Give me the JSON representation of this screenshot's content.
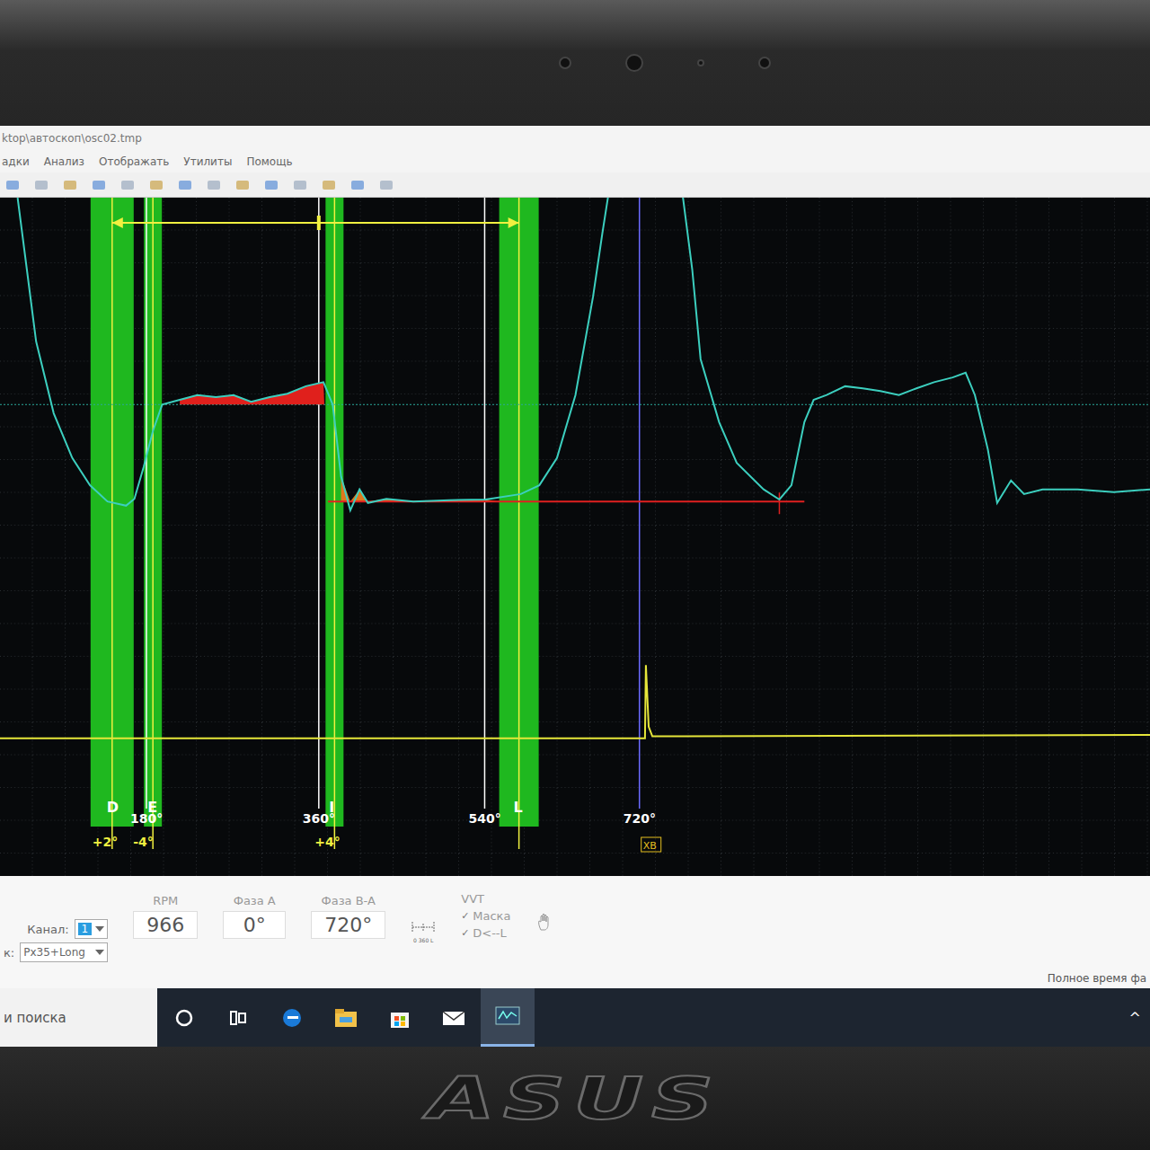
{
  "window": {
    "title": "ktop\\автоскоп\\osc02.tmp"
  },
  "menu": [
    "адки",
    "Анализ",
    "Отображать",
    "Утилиты",
    "Помощь"
  ],
  "chart": {
    "reference_level": 69.5,
    "baseline": {
      "level": 55.2,
      "from": 376,
      "to": 890,
      "cursor": 863
    },
    "series": [
      {
        "name": "pressure",
        "color": "#3ccfbf",
        "points": [
          [
            41,
            100
          ],
          [
            51,
            89.4
          ],
          [
            61,
            78.8
          ],
          [
            80,
            68.2
          ],
          [
            100,
            61.6
          ],
          [
            119,
            57.6
          ],
          [
            138,
            55.2
          ],
          [
            158,
            54.6
          ],
          [
            167,
            55.6
          ],
          [
            177,
            60.3
          ],
          [
            187,
            65.6
          ],
          [
            197,
            69.5
          ],
          [
            216,
            70.2
          ],
          [
            235,
            70.9
          ],
          [
            255,
            70.6
          ],
          [
            274,
            70.9
          ],
          [
            293,
            69.9
          ],
          [
            313,
            70.6
          ],
          [
            332,
            71.1
          ],
          [
            352,
            72.2
          ],
          [
            371,
            72.8
          ],
          [
            381,
            69.5
          ],
          [
            390,
            58.9
          ],
          [
            400,
            53.9
          ],
          [
            410,
            57
          ],
          [
            419,
            55
          ],
          [
            439,
            55.6
          ],
          [
            468,
            55.2
          ],
          [
            507,
            55.4
          ],
          [
            546,
            55.5
          ],
          [
            584,
            56.3
          ],
          [
            604,
            57.6
          ],
          [
            623,
            61.6
          ],
          [
            643,
            70.9
          ],
          [
            662,
            85.4
          ],
          [
            672,
            94.7
          ],
          [
            681,
            102.6
          ],
          [
            701,
            110
          ],
          [
            749,
            102.6
          ],
          [
            759,
            100
          ],
          [
            769,
            89.4
          ],
          [
            778,
            76.2
          ],
          [
            798,
            66.9
          ],
          [
            817,
            60.9
          ],
          [
            846,
            57
          ],
          [
            863,
            55.5
          ],
          [
            876,
            57.6
          ],
          [
            890,
            66.9
          ],
          [
            900,
            70.2
          ],
          [
            914,
            70.9
          ],
          [
            934,
            72.2
          ],
          [
            953,
            71.9
          ],
          [
            972,
            71.5
          ],
          [
            992,
            70.9
          ],
          [
            1011,
            71.9
          ],
          [
            1030,
            72.8
          ],
          [
            1050,
            73.5
          ],
          [
            1064,
            74.2
          ],
          [
            1074,
            70.9
          ],
          [
            1088,
            62.9
          ],
          [
            1098,
            55
          ],
          [
            1113,
            58.3
          ],
          [
            1127,
            56.3
          ],
          [
            1147,
            57
          ],
          [
            1185,
            57
          ],
          [
            1224,
            56.6
          ],
          [
            1263,
            57
          ]
        ]
      },
      {
        "name": "sync",
        "color": "#e6e63a",
        "points": [
          [
            0,
            20.3
          ],
          [
            718,
            20.3
          ],
          [
            719,
            31.1
          ],
          [
            722,
            22
          ],
          [
            726,
            20.6
          ],
          [
            1263,
            20.8
          ]
        ]
      }
    ],
    "highlights": [
      {
        "from": 216,
        "to": 372,
        "base": 69.5,
        "color": "#e0201c"
      },
      {
        "from": 390,
        "to": 560,
        "base": 55.2,
        "color": "#e0781c"
      }
    ],
    "markers": [
      {
        "label": "D",
        "deg": 143,
        "width": 48,
        "offset": "+2°"
      },
      {
        "label": "E",
        "deg": 187,
        "width": 20,
        "offset": "-4°"
      },
      {
        "label": "I",
        "deg": 383,
        "width": 20,
        "offset": "+4°"
      },
      {
        "label": "L",
        "deg": 582,
        "width": 44,
        "offset": ""
      }
    ],
    "ticks": [
      {
        "label": "180°",
        "deg": 180,
        "color": "#ffffff"
      },
      {
        "label": "360°",
        "deg": 366,
        "color": "#ffffff"
      },
      {
        "label": "540°",
        "deg": 545,
        "color": "#ffffff"
      },
      {
        "label": "720°",
        "deg": 712,
        "color": "#6b6bff"
      }
    ],
    "cursor_label": "XB"
  },
  "controls": {
    "channel": {
      "label": "Канал:",
      "value": "1"
    },
    "source": {
      "label": "к:",
      "value": "Px35+Long"
    },
    "fields": [
      {
        "label": "RPM",
        "value": "966"
      },
      {
        "label": "Фаза A",
        "value": "0°"
      },
      {
        "label": "Фаза B-A",
        "value": "720°"
      }
    ],
    "scale_label": "0 360 L",
    "vvt": {
      "label": "VVT",
      "options": [
        {
          "label": "Маска",
          "checked": true
        },
        {
          "label": "D<--L",
          "checked": true
        }
      ]
    },
    "status": "Полное время фа"
  },
  "taskbar": {
    "search": {
      "placeholder": "и поиска"
    },
    "apps": [
      {
        "kind": "cortana",
        "active": false
      },
      {
        "kind": "taskview",
        "active": false
      },
      {
        "kind": "edge",
        "active": false
      },
      {
        "kind": "explorer",
        "active": false
      },
      {
        "kind": "store",
        "active": false
      },
      {
        "kind": "mail",
        "active": false
      },
      {
        "kind": "scope",
        "active": true
      }
    ],
    "tray": "^"
  },
  "laptop": {
    "brand": "ASUS"
  }
}
